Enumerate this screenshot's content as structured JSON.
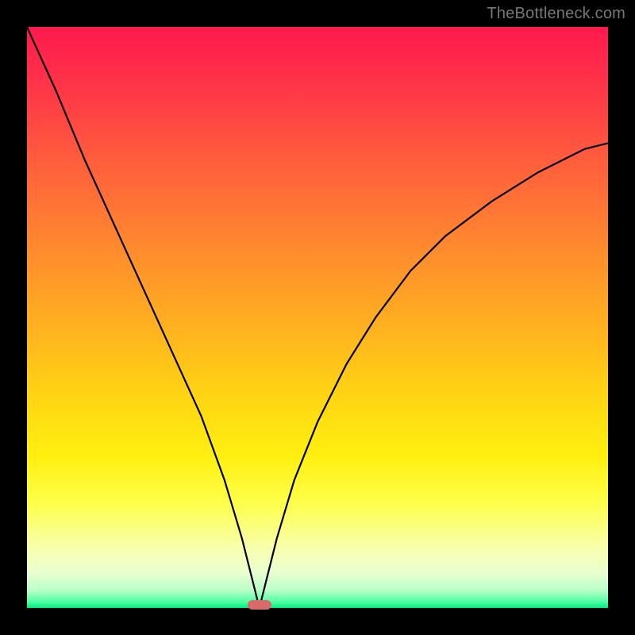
{
  "watermark": "TheBottleneck.com",
  "chart_data": {
    "type": "line",
    "title": "",
    "xlabel": "",
    "ylabel": "",
    "xlim": [
      0,
      100
    ],
    "ylim": [
      0,
      100
    ],
    "series": [
      {
        "name": "bottleneck-curve",
        "x": [
          0,
          5,
          10,
          15,
          20,
          25,
          30,
          34,
          37,
          39,
          40,
          41,
          43,
          46,
          50,
          55,
          60,
          66,
          72,
          80,
          88,
          96,
          100
        ],
        "y": [
          100,
          89,
          77,
          66,
          55,
          44,
          33,
          22,
          12,
          4,
          0,
          4,
          12,
          22,
          32,
          42,
          50,
          58,
          64,
          70,
          75,
          79,
          80
        ]
      }
    ],
    "marker": {
      "x": 40,
      "y": 0,
      "color": "#d86a6a"
    },
    "gradient_stops": [
      {
        "pct": 0,
        "color": "#ff1a4d"
      },
      {
        "pct": 50,
        "color": "#ffd613"
      },
      {
        "pct": 82,
        "color": "#fdff4a"
      },
      {
        "pct": 100,
        "color": "#00e880"
      }
    ]
  }
}
